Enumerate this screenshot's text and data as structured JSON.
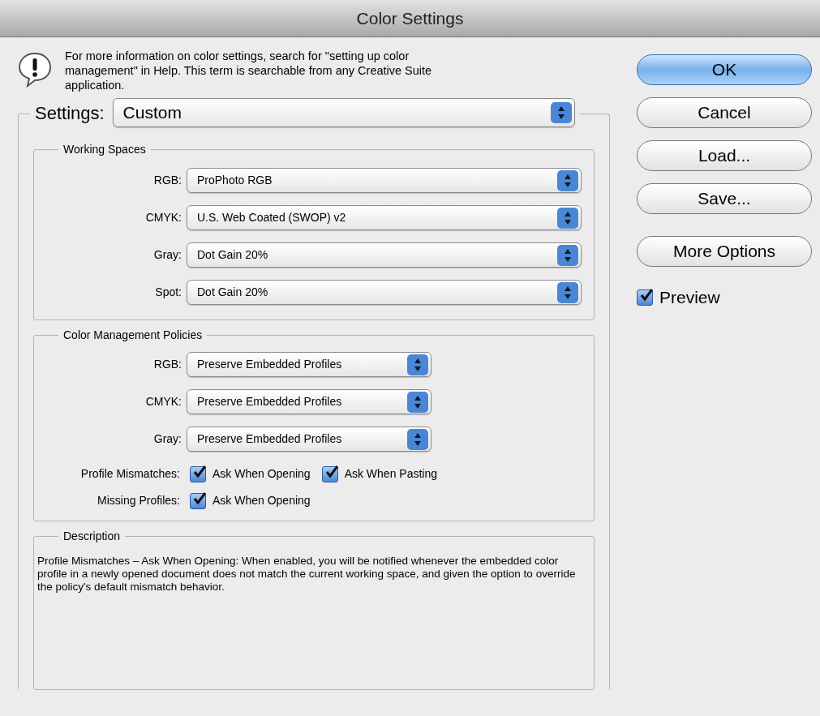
{
  "window": {
    "title": "Color Settings"
  },
  "info": {
    "text": "For more information on color settings, search for \"setting up color management\" in Help. This term is searchable from any Creative Suite application."
  },
  "settings": {
    "label": "Settings:",
    "value": "Custom"
  },
  "working_spaces": {
    "title": "Working Spaces",
    "rows": [
      {
        "label": "RGB:",
        "value": "ProPhoto RGB"
      },
      {
        "label": "CMYK:",
        "value": "U.S. Web Coated (SWOP) v2"
      },
      {
        "label": "Gray:",
        "value": "Dot Gain 20%"
      },
      {
        "label": "Spot:",
        "value": "Dot Gain 20%"
      }
    ]
  },
  "policies": {
    "title": "Color Management Policies",
    "rows": [
      {
        "label": "RGB:",
        "value": "Preserve Embedded Profiles"
      },
      {
        "label": "CMYK:",
        "value": "Preserve Embedded Profiles"
      },
      {
        "label": "Gray:",
        "value": "Preserve Embedded Profiles"
      }
    ],
    "checks": [
      {
        "label": "Profile Mismatches:",
        "options": [
          {
            "label": "Ask When Opening",
            "checked": true
          },
          {
            "label": "Ask When Pasting",
            "checked": true
          }
        ]
      },
      {
        "label": "Missing Profiles:",
        "options": [
          {
            "label": "Ask When Opening",
            "checked": true
          }
        ]
      }
    ]
  },
  "description": {
    "title": "Description",
    "text": "Profile Mismatches – Ask When Opening:  When enabled, you will be notified whenever the embedded color profile in a newly opened document does not match the current working space, and given the option to override the policy's default mismatch behavior."
  },
  "buttons": [
    {
      "label": "OK",
      "default": true
    },
    {
      "label": "Cancel",
      "default": false
    },
    {
      "label": "Load...",
      "default": false
    },
    {
      "label": "Save...",
      "default": false
    },
    {
      "label": "More Options",
      "default": false
    }
  ],
  "preview": {
    "label": "Preview",
    "checked": true
  }
}
